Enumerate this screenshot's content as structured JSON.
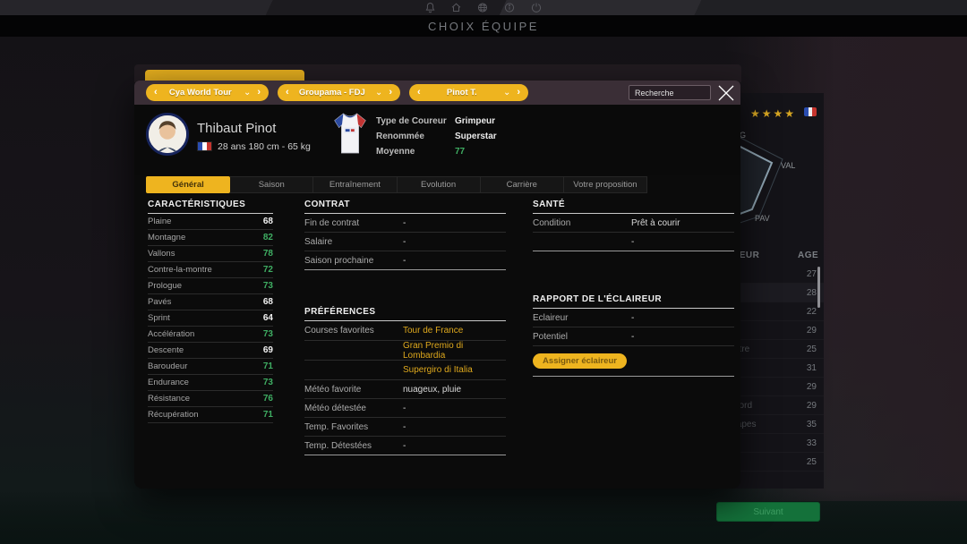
{
  "titlebar": {
    "title": "CHOIX ÉQUIPE"
  },
  "colors": {
    "accent_yellow": "#eeb41f",
    "stat_green": "#3fae63",
    "next_green": "#14713a"
  },
  "modal": {
    "header": {
      "selectors": [
        {
          "label": "Cya World Tour"
        },
        {
          "label": "Groupama - FDJ"
        },
        {
          "label": "Pinot T."
        }
      ],
      "prev_arrow": "‹",
      "next_arrow": "›",
      "dropdown_arrow": "⌄",
      "search_placeholder": "Recherche"
    },
    "rider": {
      "name": "Thibaut Pinot",
      "details": "28 ans   180 cm - 65 kg",
      "info": [
        {
          "label": "Type de Coureur",
          "value": "Grimpeur"
        },
        {
          "label": "Renommée",
          "value": "Superstar"
        },
        {
          "label": "Moyenne",
          "value": "77"
        }
      ]
    },
    "tabs": [
      {
        "label": "Général"
      },
      {
        "label": "Saison"
      },
      {
        "label": "Entraînement"
      },
      {
        "label": "Evolution"
      },
      {
        "label": "Carrière"
      },
      {
        "label": "Votre proposition"
      }
    ],
    "characteristics": {
      "title": "CARACTÉRISTIQUES",
      "rows": [
        {
          "label": "Plaine",
          "value": "68",
          "tone": "white"
        },
        {
          "label": "Montagne",
          "value": "82",
          "tone": "green"
        },
        {
          "label": "Vallons",
          "value": "78",
          "tone": "green"
        },
        {
          "label": "Contre-la-montre",
          "value": "72",
          "tone": "green"
        },
        {
          "label": "Prologue",
          "value": "73",
          "tone": "green"
        },
        {
          "label": "Pavés",
          "value": "68",
          "tone": "white"
        },
        {
          "label": "Sprint",
          "value": "64",
          "tone": "white"
        },
        {
          "label": "Accélération",
          "value": "73",
          "tone": "green"
        },
        {
          "label": "Descente",
          "value": "69",
          "tone": "white"
        },
        {
          "label": "Baroudeur",
          "value": "71",
          "tone": "green"
        },
        {
          "label": "Endurance",
          "value": "73",
          "tone": "green"
        },
        {
          "label": "Résistance",
          "value": "76",
          "tone": "green"
        },
        {
          "label": "Récupération",
          "value": "71",
          "tone": "green"
        }
      ]
    },
    "contract": {
      "title": "CONTRAT",
      "rows": [
        {
          "label": "Fin de contrat",
          "value": "-"
        },
        {
          "label": "Salaire",
          "value": "-"
        },
        {
          "label": "Saison prochaine",
          "value": "-"
        }
      ]
    },
    "preferences": {
      "title": "PRÉFÉRENCES",
      "rows": [
        {
          "label": "Courses favorites",
          "value": "Tour de France",
          "tone": "yellow"
        },
        {
          "label": "",
          "value": "Gran Premio di Lombardia",
          "tone": "yellow"
        },
        {
          "label": "",
          "value": "Supergiro di Italia",
          "tone": "yellow"
        },
        {
          "label": "Météo favorite",
          "value": "nuageux, pluie",
          "tone": "white"
        },
        {
          "label": "Météo détestée",
          "value": "-",
          "tone": "white"
        },
        {
          "label": "Temp. Favorites",
          "value": "-",
          "tone": "white"
        },
        {
          "label": "Temp. Détestées",
          "value": "-",
          "tone": "white"
        }
      ]
    },
    "health": {
      "title": "SANTÉ",
      "rows": [
        {
          "label": "Condition",
          "value": "Prêt à courir"
        },
        {
          "label": "",
          "value": "-"
        }
      ]
    },
    "scout": {
      "title": "RAPPORT DE L'ÉCLAIREUR",
      "rows": [
        {
          "label": "Eclaireur",
          "value": "-"
        },
        {
          "label": "Potentiel",
          "value": "-"
        }
      ],
      "button_label": "Assigner éclaireur"
    }
  },
  "background": {
    "panel": {
      "stars": "★★★★",
      "radar_labels": [
        {
          "text": "G"
        },
        {
          "text": "VAL"
        },
        {
          "text": "PAV"
        }
      ],
      "table": {
        "header_left_fragment": "REUR",
        "header_age": "AGE",
        "rows": [
          {
            "fragment": "",
            "age": "27"
          },
          {
            "fragment": "",
            "age": "28"
          },
          {
            "fragment": "",
            "age": "22"
          },
          {
            "fragment": "",
            "age": "29"
          },
          {
            "fragment": "ntre",
            "age": "25"
          },
          {
            "fragment": "",
            "age": "31"
          },
          {
            "fragment": "",
            "age": "29"
          },
          {
            "fragment": "nord",
            "age": "29"
          },
          {
            "fragment": "tapes",
            "age": "35"
          },
          {
            "fragment": "",
            "age": "33"
          },
          {
            "fragment": "",
            "age": "25"
          }
        ]
      }
    }
  },
  "footer": {
    "next_label": "Suivant"
  }
}
